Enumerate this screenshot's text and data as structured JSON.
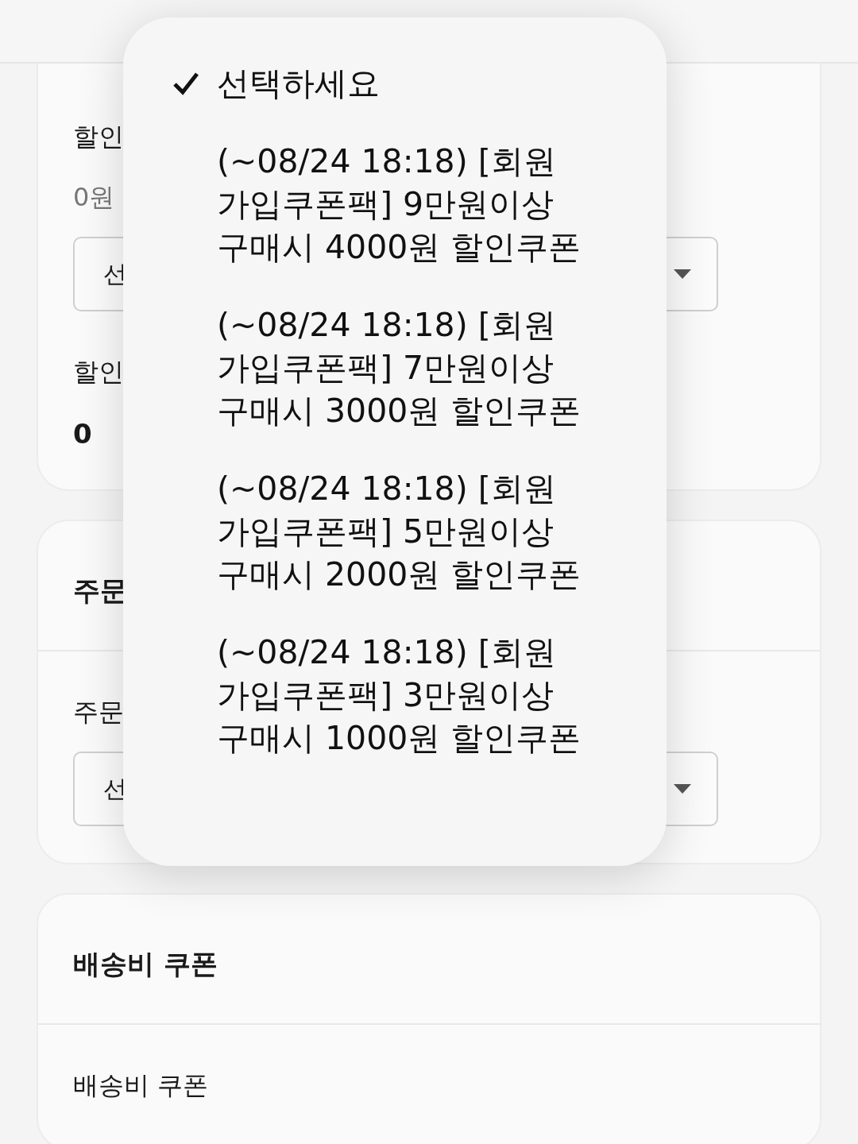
{
  "discount_card": {
    "label": "할인",
    "amount": "0원",
    "select": {
      "value": "선"
    },
    "label_2": "할인",
    "value": "0"
  },
  "order_card": {
    "title": "주문",
    "label": "주문",
    "select": {
      "value": "선"
    }
  },
  "shipping_card": {
    "title": "배송비 쿠폰",
    "label": "배송비 쿠폰"
  },
  "dropdown": {
    "options": [
      {
        "text": "선택하세요",
        "selected": true
      },
      {
        "text": "(~08/24 18:18) [회원 가입쿠폰팩] 9만원이상 구매시 4000원 할인쿠폰",
        "selected": false
      },
      {
        "text": "(~08/24 18:18) [회원 가입쿠폰팩] 7만원이상 구매시 3000원 할인쿠폰",
        "selected": false
      },
      {
        "text": "(~08/24 18:18) [회원 가입쿠폰팩] 5만원이상 구매시 2000원 할인쿠폰",
        "selected": false
      },
      {
        "text": "(~08/24 18:18) [회원 가입쿠폰팩] 3만원이상 구매시 1000원 할인쿠폰",
        "selected": false
      }
    ]
  }
}
